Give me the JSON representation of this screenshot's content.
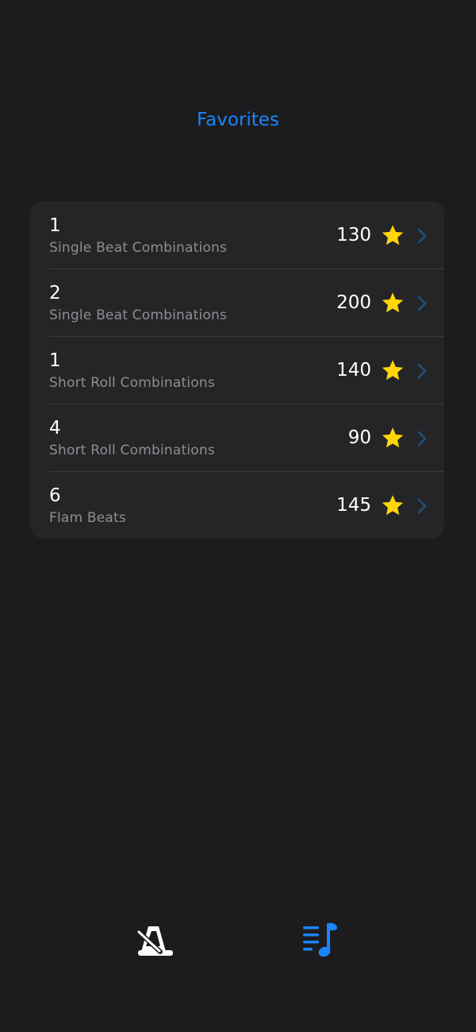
{
  "header": {
    "title": "Favorites"
  },
  "favorites": [
    {
      "number": "1",
      "category": "Single Beat Combinations",
      "tempo": "130"
    },
    {
      "number": "2",
      "category": "Single Beat Combinations",
      "tempo": "200"
    },
    {
      "number": "1",
      "category": "Short Roll Combinations",
      "tempo": "140"
    },
    {
      "number": "4",
      "category": "Short Roll Combinations",
      "tempo": "90"
    },
    {
      "number": "6",
      "category": "Flam Beats",
      "tempo": "145"
    }
  ],
  "icons": {
    "row_favorite": "star-icon",
    "row_disclosure": "chevron-right-icon",
    "tab_1": "metronome-icon",
    "tab_2": "music-list-icon"
  },
  "tabbar": {
    "selected_index": 1
  },
  "colors": {
    "background": "#1c1c1e",
    "card": "#252527",
    "accent": "#1a85ff",
    "star": "#ffd60a",
    "secondary_text": "#8e8e93",
    "chevron": "#1f4f7a"
  }
}
